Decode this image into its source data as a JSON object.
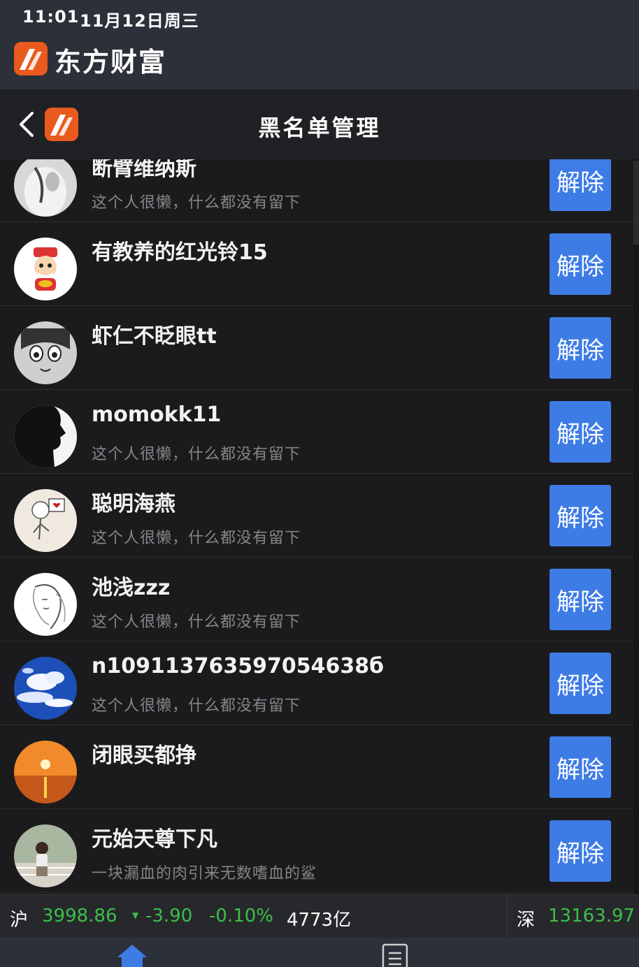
{
  "status": {
    "time": "11:01",
    "date": "11月12日周三"
  },
  "app": {
    "name": "东方财富"
  },
  "nav": {
    "title": "黑名单管理"
  },
  "button_label": "解除",
  "users": [
    {
      "name": "断臂维纳斯",
      "signature": "这个人很懒，什么都没有留下",
      "avatar": "statue-avatar"
    },
    {
      "name": "有教养的红光铃15",
      "signature": "",
      "avatar": "cartoon-god-of-wealth-avatar"
    },
    {
      "name": "虾仁不眨眼tt",
      "signature": "",
      "avatar": "anime-face-avatar"
    },
    {
      "name": "momokk11",
      "signature": "这个人很懒，什么都没有留下",
      "avatar": "silhouette-avatar"
    },
    {
      "name": "聪明海燕",
      "signature": "这个人很懒，什么都没有留下",
      "avatar": "heart-doll-avatar"
    },
    {
      "name": "池浅zzz",
      "signature": "这个人很懒，什么都没有留下",
      "avatar": "sketch-girl-avatar"
    },
    {
      "name": "n109113763597054638б",
      "signature": "这个人很懒，什么都没有留下",
      "avatar": "blue-sky-avatar"
    },
    {
      "name": "闭眼买都挣",
      "signature": "",
      "avatar": "sunset-avatar"
    },
    {
      "name": "元始天尊下凡",
      "signature": "一块漏血的肉引来无数嗜血的鲨",
      "avatar": "girl-photo-avatar"
    }
  ],
  "ticker": {
    "sh_label": "沪",
    "sh_value": "3998.86",
    "sh_arrow": "▼",
    "sh_change": "-3.90",
    "sh_pct": "-0.10%",
    "sh_volume": "4773亿",
    "sz_label": "深",
    "sz_value": "13163.97"
  },
  "colors": {
    "accent": "#3e7ce5",
    "brand": "#e85a1e",
    "down": "#3bbf4a"
  }
}
